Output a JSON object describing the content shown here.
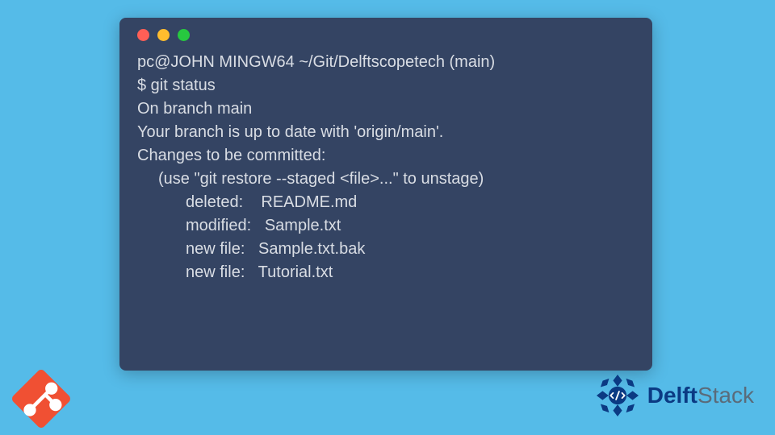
{
  "terminal": {
    "prompt": "pc@JOHN MINGW64 ~/Git/Delftscopetech (main)",
    "command": "$ git status",
    "branch_line": "On branch main",
    "uptodate_line": "Your branch is up to date with 'origin/main'.",
    "changes_header": "Changes to be committed:",
    "unstage_hint": "(use \"git restore --staged <file>...\" to unstage)",
    "entries": [
      "deleted:    README.md",
      "modified:   Sample.txt",
      "new file:   Sample.txt.bak",
      "new file:   Tutorial.txt"
    ]
  },
  "logo": {
    "part1": "Delft",
    "part2": "Stack"
  }
}
